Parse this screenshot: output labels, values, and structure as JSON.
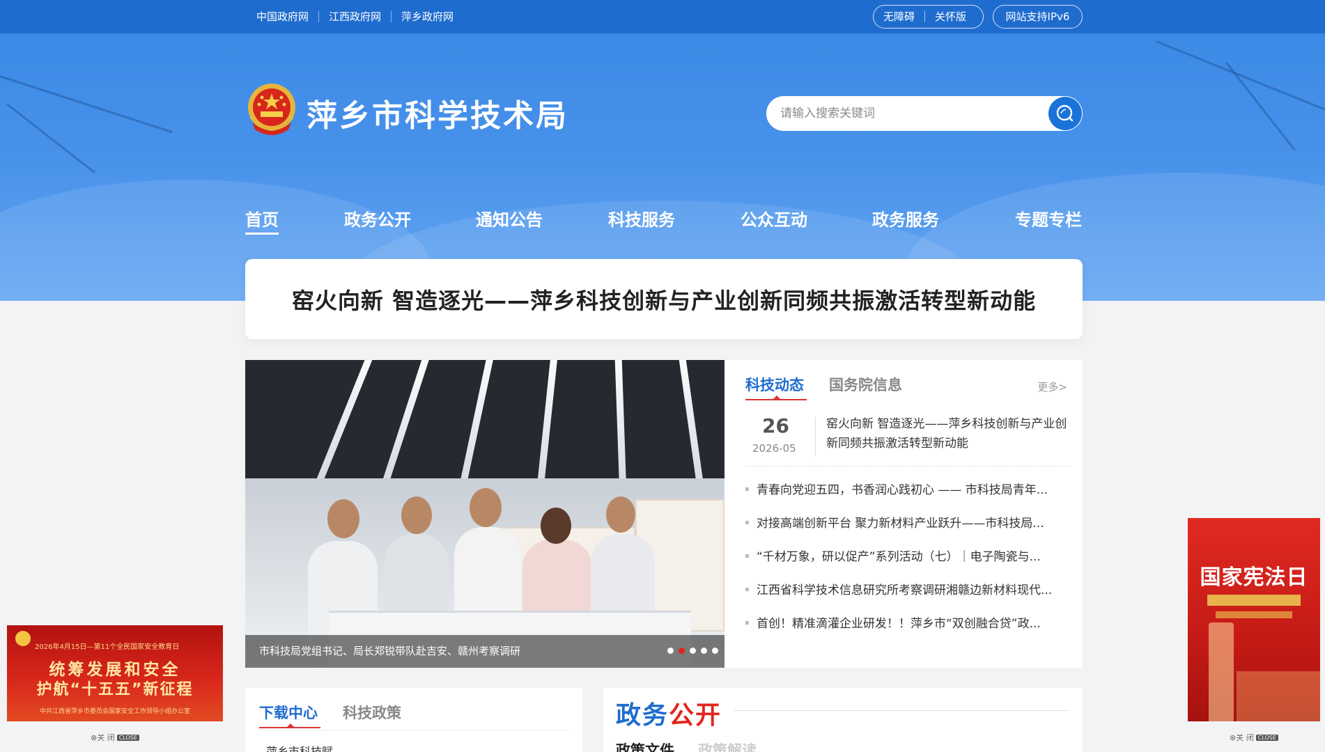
{
  "topbar": {
    "links": [
      "中国政府网",
      "江西政府网",
      "萍乡政府网"
    ],
    "accessibility": "无障碍",
    "care_mode": "关怀版",
    "ipv6": "网站支持IPv6"
  },
  "header": {
    "site_title": "萍乡市科学技术局",
    "search_placeholder": "请输入搜索关键词"
  },
  "nav": {
    "items": [
      "首页",
      "政务公开",
      "通知公告",
      "科技服务",
      "公众互动",
      "政务服务",
      "专题专栏"
    ],
    "active": "首页"
  },
  "headline": "窑火向新 智造逐光——萍乡科技创新与产业创新同频共振激活转型新动能",
  "slider": {
    "caption": "市科技局党组书记、局长郑锐带队赴吉安、赣州考察调研",
    "dot_count": 5,
    "active_dot": 2
  },
  "news": {
    "tabs": [
      "科技动态",
      "国务院信息"
    ],
    "active_tab": "科技动态",
    "more": "更多>",
    "top_item": {
      "day": "26",
      "year_month": "2026-05",
      "title": "窑火向新 智造逐光——萍乡科技创新与产业创新同频共振激活转型新动能"
    },
    "items": [
      "青春向党迎五四，书香润心践初心 —— 市科技局青年...",
      "对接高端创新平台 聚力新材料产业跃升——市科技局...",
      "“千材万象，研以促产”系列活动（七）｜电子陶瓷与...",
      "江西省科学技术信息研究所考察调研湘赣边新材料现代...",
      "首创！精准滴灌企业研发！！萍乡市“双创融合贷”政..."
    ]
  },
  "ads": {
    "left": {
      "top_text": "2026年4月15日—第11个全民国家安全教育日",
      "line1": "统筹发展和安全",
      "line2": "护航“十五五”新征程",
      "bottom_text": "中共江西省萍乡市委员会国家安全工作领导小组办公室",
      "close": "⊗关 闭",
      "close_tag": "CLOSE"
    },
    "right": {
      "title": "国家宪法日",
      "close": "⊗关 闭",
      "close_tag": "CLOSE"
    }
  },
  "download": {
    "tabs": [
      "下载中心",
      "科技政策"
    ],
    "active_tab": "下载中心",
    "first_item": "萍乡市科技赋"
  },
  "gov_open": {
    "title_a": "政务",
    "title_b": "公开",
    "tabs": [
      "政策文件",
      "政策解读"
    ],
    "active_tab": "政策文件"
  },
  "colors": {
    "brand_blue": "#1f6ccf",
    "accent_red": "#e0261d"
  }
}
